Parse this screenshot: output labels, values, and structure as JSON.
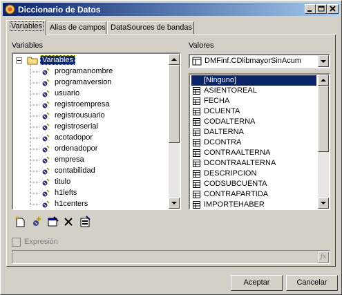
{
  "window": {
    "title": "Diccionario de Datos"
  },
  "tabs": [
    {
      "label": "Variables"
    },
    {
      "label": "Alias de campos"
    },
    {
      "label": "DataSources de bandas"
    }
  ],
  "left": {
    "label": "Variables",
    "root": "Variables",
    "items": [
      "programanombre",
      "programaversion",
      "usuario",
      "registroempresa",
      "registrousuario",
      "registroserial",
      "acotadopor",
      "ordenadopor",
      "empresa",
      "contabilidad",
      "titulo",
      "h1lefts",
      "h1centers"
    ]
  },
  "right": {
    "label": "Valores",
    "datasource": "DMFinf.CDlibmayorSinAcum",
    "fields": [
      "[Ninguno]",
      "ASIENTOREAL",
      "FECHA",
      "DCUENTA",
      "CODALTERNA",
      "DALTERNA",
      "DCONTRA",
      "CONTRAALTERNA",
      "DCONTRAALTERNA",
      "DESCRIPCION",
      "CODSUBCUENTA",
      "CONTRAPARTIDA",
      "IMPORTEHABER"
    ]
  },
  "expression": {
    "label": "Expresión",
    "value": ""
  },
  "buttons": {
    "accept": "Aceptar",
    "cancel": "Cancelar"
  },
  "colors": {
    "selection": "#0a246a",
    "title_start": "#0a246a",
    "title_end": "#a6caf0"
  }
}
